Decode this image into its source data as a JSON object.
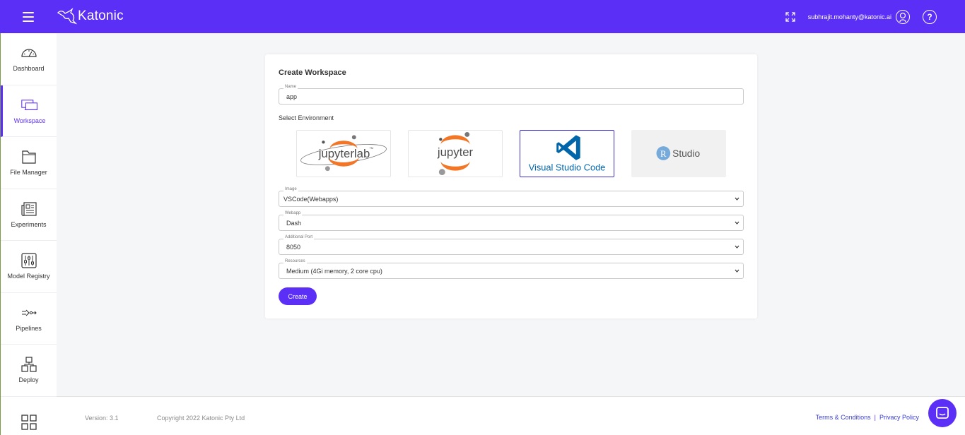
{
  "header": {
    "logo_text": "Katonic",
    "user_email": "subhrajit.mohanty@katonic.ai",
    "help_glyph": "?"
  },
  "sidebar": {
    "items": [
      {
        "label": "Dashboard",
        "icon": "gauge-icon"
      },
      {
        "label": "Workspace",
        "icon": "laptop-icon",
        "active": true
      },
      {
        "label": "File Manager",
        "icon": "folder-icon"
      },
      {
        "label": "Experiments",
        "icon": "newspaper-icon"
      },
      {
        "label": "Model Registry",
        "icon": "sliders-icon"
      },
      {
        "label": "Pipelines",
        "icon": "pipeline-icon"
      },
      {
        "label": "Deploy",
        "icon": "deploy-icon"
      },
      {
        "label": "",
        "icon": "grid-icon"
      }
    ]
  },
  "form": {
    "title": "Create Workspace",
    "name": {
      "label": "Name",
      "value": "app"
    },
    "env_label": "Select Environment",
    "environments": [
      {
        "name": "jupyterlab",
        "suffix": "TM",
        "selected": false
      },
      {
        "name": "jupyter",
        "selected": false
      },
      {
        "name": "Visual Studio Code",
        "selected": true
      },
      {
        "name": "Studio",
        "badge": "R",
        "selected": false
      }
    ],
    "image": {
      "label": "Image",
      "value": "VSCode(Webapps)"
    },
    "webapp": {
      "label": "Webapp",
      "value": "Dash"
    },
    "port": {
      "label": "Additional Port",
      "value": "8050"
    },
    "resources": {
      "label": "Resources",
      "value": "Medium (4Gi memory, 2 core cpu)"
    },
    "create_label": "Create"
  },
  "footer": {
    "version": "Version: 3.1",
    "copyright": "Copyright 2022 Katonic Pty Ltd",
    "terms": "Terms & Conditions",
    "separator": "|",
    "privacy": "Privacy Policy"
  },
  "colors": {
    "brand": "#5b2ff5",
    "jupyter_orange": "#f37626",
    "vscode_blue": "#0065a9",
    "rstudio_blue": "#75aadb"
  }
}
